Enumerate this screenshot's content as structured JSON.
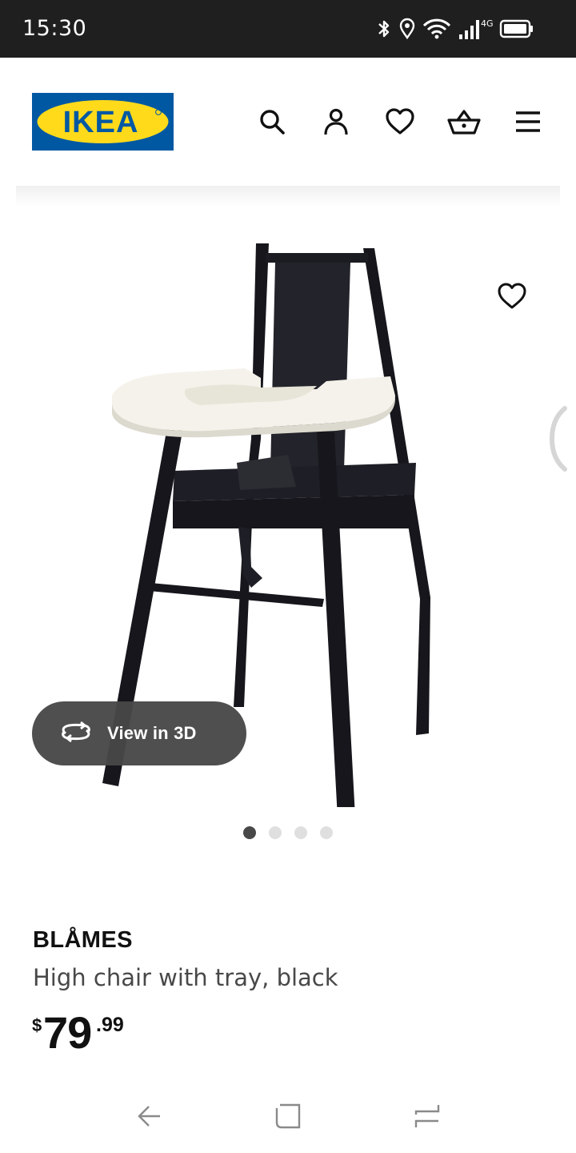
{
  "status_bar": {
    "time": "15:30",
    "network": "4G",
    "icons": [
      "bluetooth-icon",
      "location-icon",
      "wifi-icon",
      "signal-icon",
      "battery-icon"
    ]
  },
  "header": {
    "logo_text": "IKEA",
    "icons": [
      "search-icon",
      "profile-icon",
      "heart-icon",
      "basket-icon",
      "menu-icon"
    ],
    "brand_colors": {
      "blue": "#0058a3",
      "yellow": "#ffda1a"
    }
  },
  "gallery": {
    "view_3d_label": "View in 3D",
    "total_images": 4,
    "active_image": 1
  },
  "product": {
    "name": "BLÅMES",
    "description": "High chair with tray, black",
    "price": {
      "currency": "$",
      "integer": "79",
      "decimal": ".99"
    }
  },
  "nav_bar": {
    "icons": [
      "back-icon",
      "home-icon",
      "recents-icon"
    ]
  }
}
